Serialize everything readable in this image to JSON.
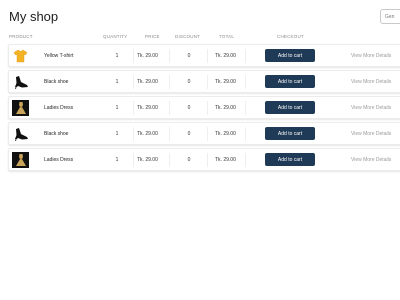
{
  "page": {
    "title": "My shop",
    "top_button_label": "Gen"
  },
  "columns": {
    "product": "PRODUCT",
    "quantity": "QUANTITY",
    "price": "PRICE",
    "discount": "DISCOUNT",
    "total": "TOTAL",
    "checkout": "CHECKOUT"
  },
  "rows": [
    {
      "name": "Yellow T-shirt",
      "image": "yellow-tshirt",
      "quantity": "1",
      "price": "Tk. 29.00",
      "discount": "0",
      "total": "Tk. 29.00",
      "cta": "Add to cart",
      "details": "View More Details"
    },
    {
      "name": "Black shoe",
      "image": "black-shoe",
      "quantity": "1",
      "price": "Tk. 29.00",
      "discount": "0",
      "total": "Tk. 29.00",
      "cta": "Add to cart",
      "details": "View More Details"
    },
    {
      "name": "Ladies Dress",
      "image": "ladies-dress",
      "quantity": "1",
      "price": "Tk. 29.00",
      "discount": "0",
      "total": "Tk. 29.00",
      "cta": "Add to cart",
      "details": "View More Details"
    },
    {
      "name": "Black shoe",
      "image": "black-shoe",
      "quantity": "1",
      "price": "Tk. 29.00",
      "discount": "0",
      "total": "Tk. 29.00",
      "cta": "Add to cart",
      "details": "View More Details"
    },
    {
      "name": "Ladies Dress",
      "image": "ladies-dress",
      "quantity": "1",
      "price": "Tk. 29.00",
      "discount": "0",
      "total": "Tk. 29.00",
      "cta": "Add to cart",
      "details": "View More Details"
    }
  ],
  "colors": {
    "button_bg": "#1f3a57",
    "button_text": "#ffffff",
    "muted_text": "#9a9a9a"
  }
}
